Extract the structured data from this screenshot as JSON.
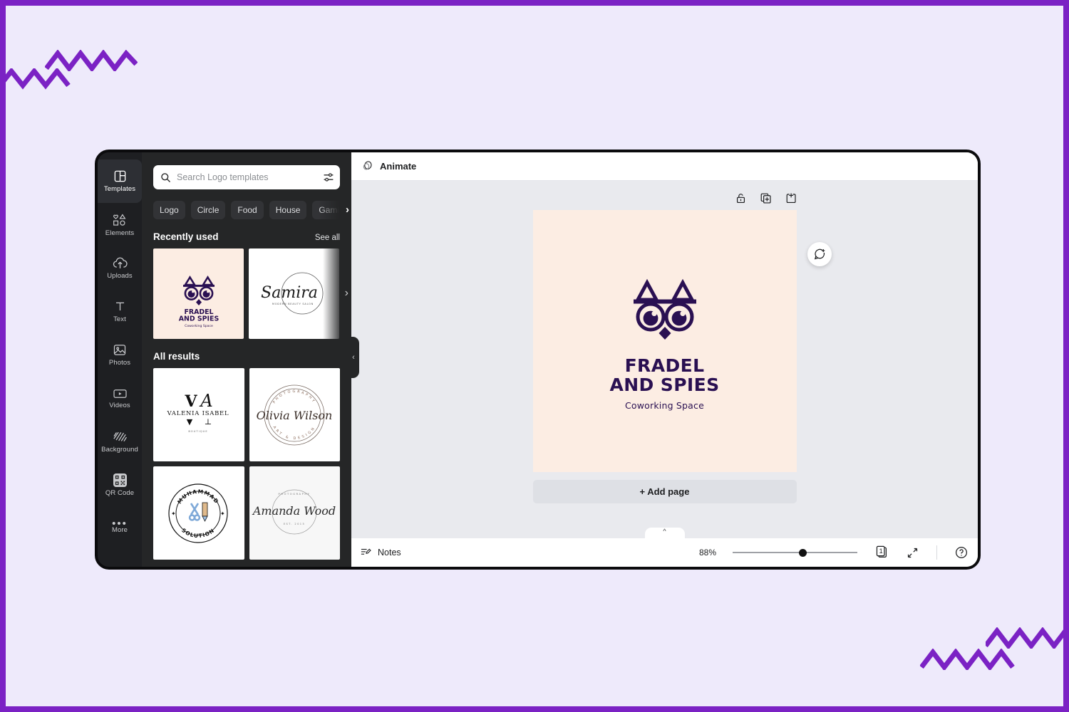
{
  "theme": {
    "background": "#EEEAFB",
    "frame_border": "#7B22C4",
    "zigzag": "#7B22C4",
    "panel_dark": "#252627",
    "rail_dark": "#1E1F22",
    "stage_gray": "#E9EAEE",
    "canvas_peach": "#FCEDE3",
    "logo_purple": "#2A1052"
  },
  "rail": {
    "items": [
      {
        "label": "Templates",
        "icon": "templates-icon",
        "active": true
      },
      {
        "label": "Elements",
        "icon": "elements-icon",
        "active": false
      },
      {
        "label": "Uploads",
        "icon": "uploads-icon",
        "active": false
      },
      {
        "label": "Text",
        "icon": "text-icon",
        "active": false
      },
      {
        "label": "Photos",
        "icon": "photos-icon",
        "active": false
      },
      {
        "label": "Videos",
        "icon": "videos-icon",
        "active": false
      },
      {
        "label": "Background",
        "icon": "background-icon",
        "active": false
      },
      {
        "label": "QR Code",
        "icon": "qrcode-icon",
        "active": false
      },
      {
        "label": "More",
        "icon": "more-dots-icon",
        "active": false
      }
    ]
  },
  "panel": {
    "search": {
      "placeholder": "Search Logo templates",
      "value": "",
      "icon": "search-icon",
      "filter_icon": "filter-sliders-icon"
    },
    "chips": [
      "Logo",
      "Circle",
      "Food",
      "House",
      "Gaming"
    ],
    "chips_next_icon": "chevron-right-icon",
    "recently_used": {
      "title": "Recently used",
      "see_all": "See all",
      "next_icon": "chevron-right-icon",
      "items": [
        {
          "name": "FRADEL AND SPIES",
          "subtitle": "Coworking Space",
          "style": "owl-peach"
        },
        {
          "name": "Samira",
          "subtitle": "MODERN BEAUTY SALON",
          "style": "script-circle"
        }
      ]
    },
    "all_results": {
      "title": "All results",
      "items": [
        {
          "name": "VALENIA ISABEL",
          "subtitle": "BOUTIQUE",
          "style": "monogram"
        },
        {
          "name": "Olivia Wilson",
          "top_text": "PHOTOGRAPHY",
          "bottom_text": "ART & DESIGN",
          "style": "stamp-circle"
        },
        {
          "name": "MUHAMMAD",
          "bottom_text": "SOLUTION",
          "style": "badge-tools"
        },
        {
          "name": "Amanda Wood",
          "top_text": "PHOTOGRAPHY",
          "bottom_text": "EST. 2015",
          "style": "script-light"
        }
      ]
    },
    "collapse_icon": "chevron-left-icon"
  },
  "editor": {
    "topbar": {
      "label": "Animate",
      "icon": "animate-icon"
    },
    "page_tools": [
      {
        "name": "lock-icon",
        "label": "Lock"
      },
      {
        "name": "duplicate-page-icon",
        "label": "Duplicate page"
      },
      {
        "name": "add-page-icon",
        "label": "Add page"
      }
    ],
    "comment_button_icon": "comment-add-icon",
    "canvas": {
      "logo_icon": "owl-logo-icon",
      "title_line1": "FRADEL",
      "title_line2": "AND SPIES",
      "subtitle": "Coworking Space"
    },
    "add_page_label": "+ Add page",
    "stage_handle_icon": "chevron-up-icon",
    "bottombar": {
      "notes_label": "Notes",
      "notes_icon": "notes-icon",
      "zoom_percent": "88%",
      "slider_position_percent": 53,
      "page_count": "1",
      "page_count_icon": "pages-icon",
      "fullscreen_icon": "expand-arrows-icon",
      "help_icon": "help-circle-icon"
    }
  }
}
